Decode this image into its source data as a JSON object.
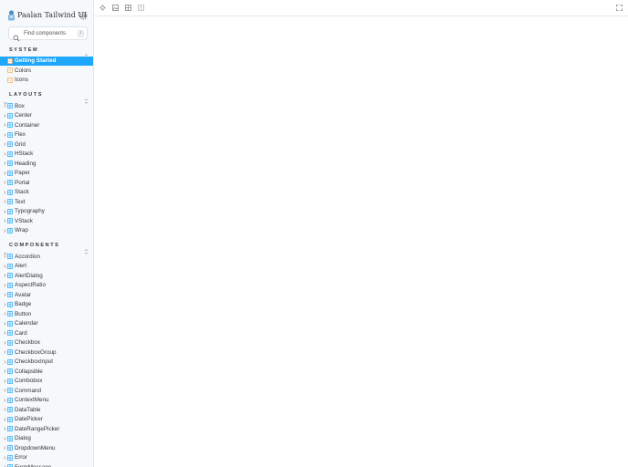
{
  "brand": {
    "title": "Paalan Tailwind UI"
  },
  "search": {
    "placeholder": "Find components",
    "shortcut": "/"
  },
  "system": {
    "title": "SYSTEM",
    "items": [
      {
        "label": "Getting Started",
        "icon": "document-icon",
        "active": true
      },
      {
        "label": "Colors",
        "icon": "document-icon"
      },
      {
        "label": "Icons",
        "icon": "document-icon"
      }
    ]
  },
  "layouts": {
    "title": "LAYOUTS",
    "items": [
      "Box",
      "Center",
      "Container",
      "Flex",
      "Grid",
      "HStack",
      "Heading",
      "Paper",
      "Portal",
      "Stack",
      "Text",
      "Typography",
      "VStack",
      "Wrap"
    ]
  },
  "components": {
    "title": "COMPONENTS",
    "items": [
      "Accordion",
      "Alert",
      "AlertDialog",
      "AspectRatio",
      "Avatar",
      "Badge",
      "Button",
      "Calendar",
      "Card",
      "Checkbox",
      "CheckboxGroup",
      "CheckboxInput",
      "Collapsible",
      "Combobox",
      "Command",
      "ContextMenu",
      "DataTable",
      "DatePicker",
      "DateRangePicker",
      "Dialog",
      "DropdownMenu",
      "Error",
      "FormMessage"
    ]
  },
  "colors": {
    "accent": "#1ea7fd",
    "component_icon": "#1ea7fd",
    "doc_icon": "#f0a860",
    "sidebar_bg": "#f6f9fc"
  }
}
